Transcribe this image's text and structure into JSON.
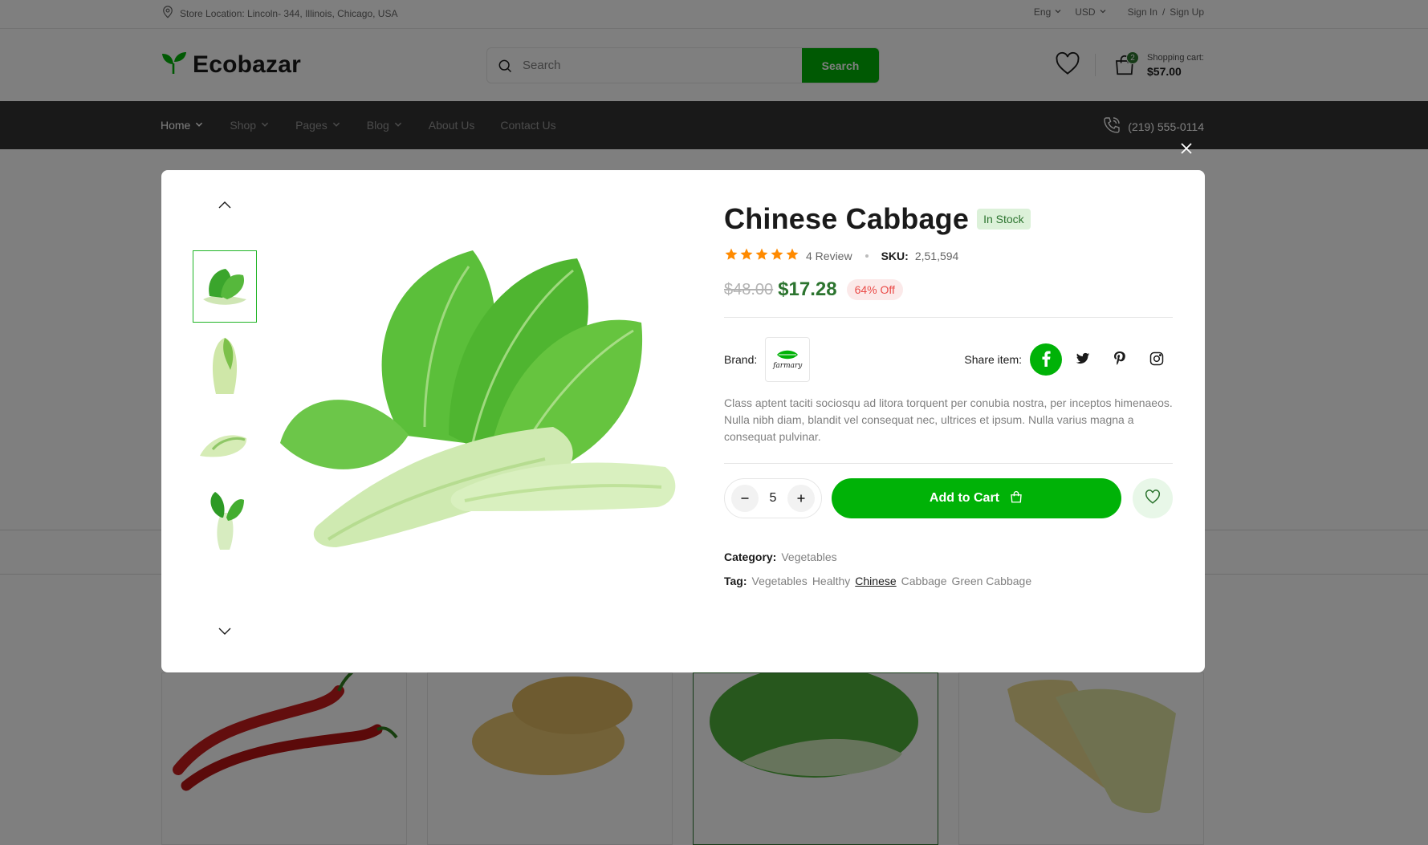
{
  "topbar": {
    "location": "Store Location: Lincoln- 344, Illinois, Chicago, USA",
    "language": "Eng",
    "currency": "USD",
    "sign_in": "Sign In",
    "separator": "/",
    "sign_up": "Sign Up"
  },
  "header": {
    "logo_text": "Ecobazar",
    "search_placeholder": "Search",
    "search_button": "Search",
    "cart_label": "Shopping cart:",
    "cart_amount": "$57.00",
    "cart_count": "2"
  },
  "nav": {
    "items": [
      {
        "label": "Home"
      },
      {
        "label": "Shop"
      },
      {
        "label": "Pages"
      },
      {
        "label": "Blog"
      },
      {
        "label": "About Us"
      },
      {
        "label": "Contact Us"
      }
    ],
    "phone": "(219) 555-0114"
  },
  "product": {
    "title": "Chinese Cabbage",
    "stock": "In Stock",
    "rating": 5,
    "reviews": "4 Review",
    "sku_label": "SKU:",
    "sku": "2,51,594",
    "old_price": "$48.00",
    "new_price": "$17.28",
    "discount": "64% Off",
    "brand_label": "Brand:",
    "brand_logo_text": "farmary",
    "share_label": "Share item:",
    "description": "Class aptent taciti sociosqu ad litora torquent per conubia nostra, per inceptos himenaeos. Nulla nibh diam, blandit vel consequat nec, ultrices et ipsum. Nulla varius magna a consequat pulvinar.",
    "quantity": "5",
    "add_to_cart": "Add to Cart",
    "category_label": "Category:",
    "category": "Vegetables",
    "tag_label": "Tag:",
    "tags": [
      "Vegetables",
      "Healthy",
      "Chinese",
      "Cabbage",
      "Green Cabbage"
    ]
  },
  "colors": {
    "primary_green": "#00b207",
    "dark_green": "#2c742f",
    "sale_red": "#ea4b48",
    "star_orange": "#ff8a00",
    "nav_bg": "#333333"
  },
  "icons": [
    "map-pin-icon",
    "chevron-down-icon",
    "search-icon",
    "heart-icon",
    "shopping-bag-icon",
    "phone-icon",
    "close-icon",
    "chevron-up-icon",
    "star-icon",
    "facebook-icon",
    "twitter-icon",
    "pinterest-icon",
    "instagram-icon",
    "minus-icon",
    "plus-icon",
    "lock-bag-icon"
  ]
}
